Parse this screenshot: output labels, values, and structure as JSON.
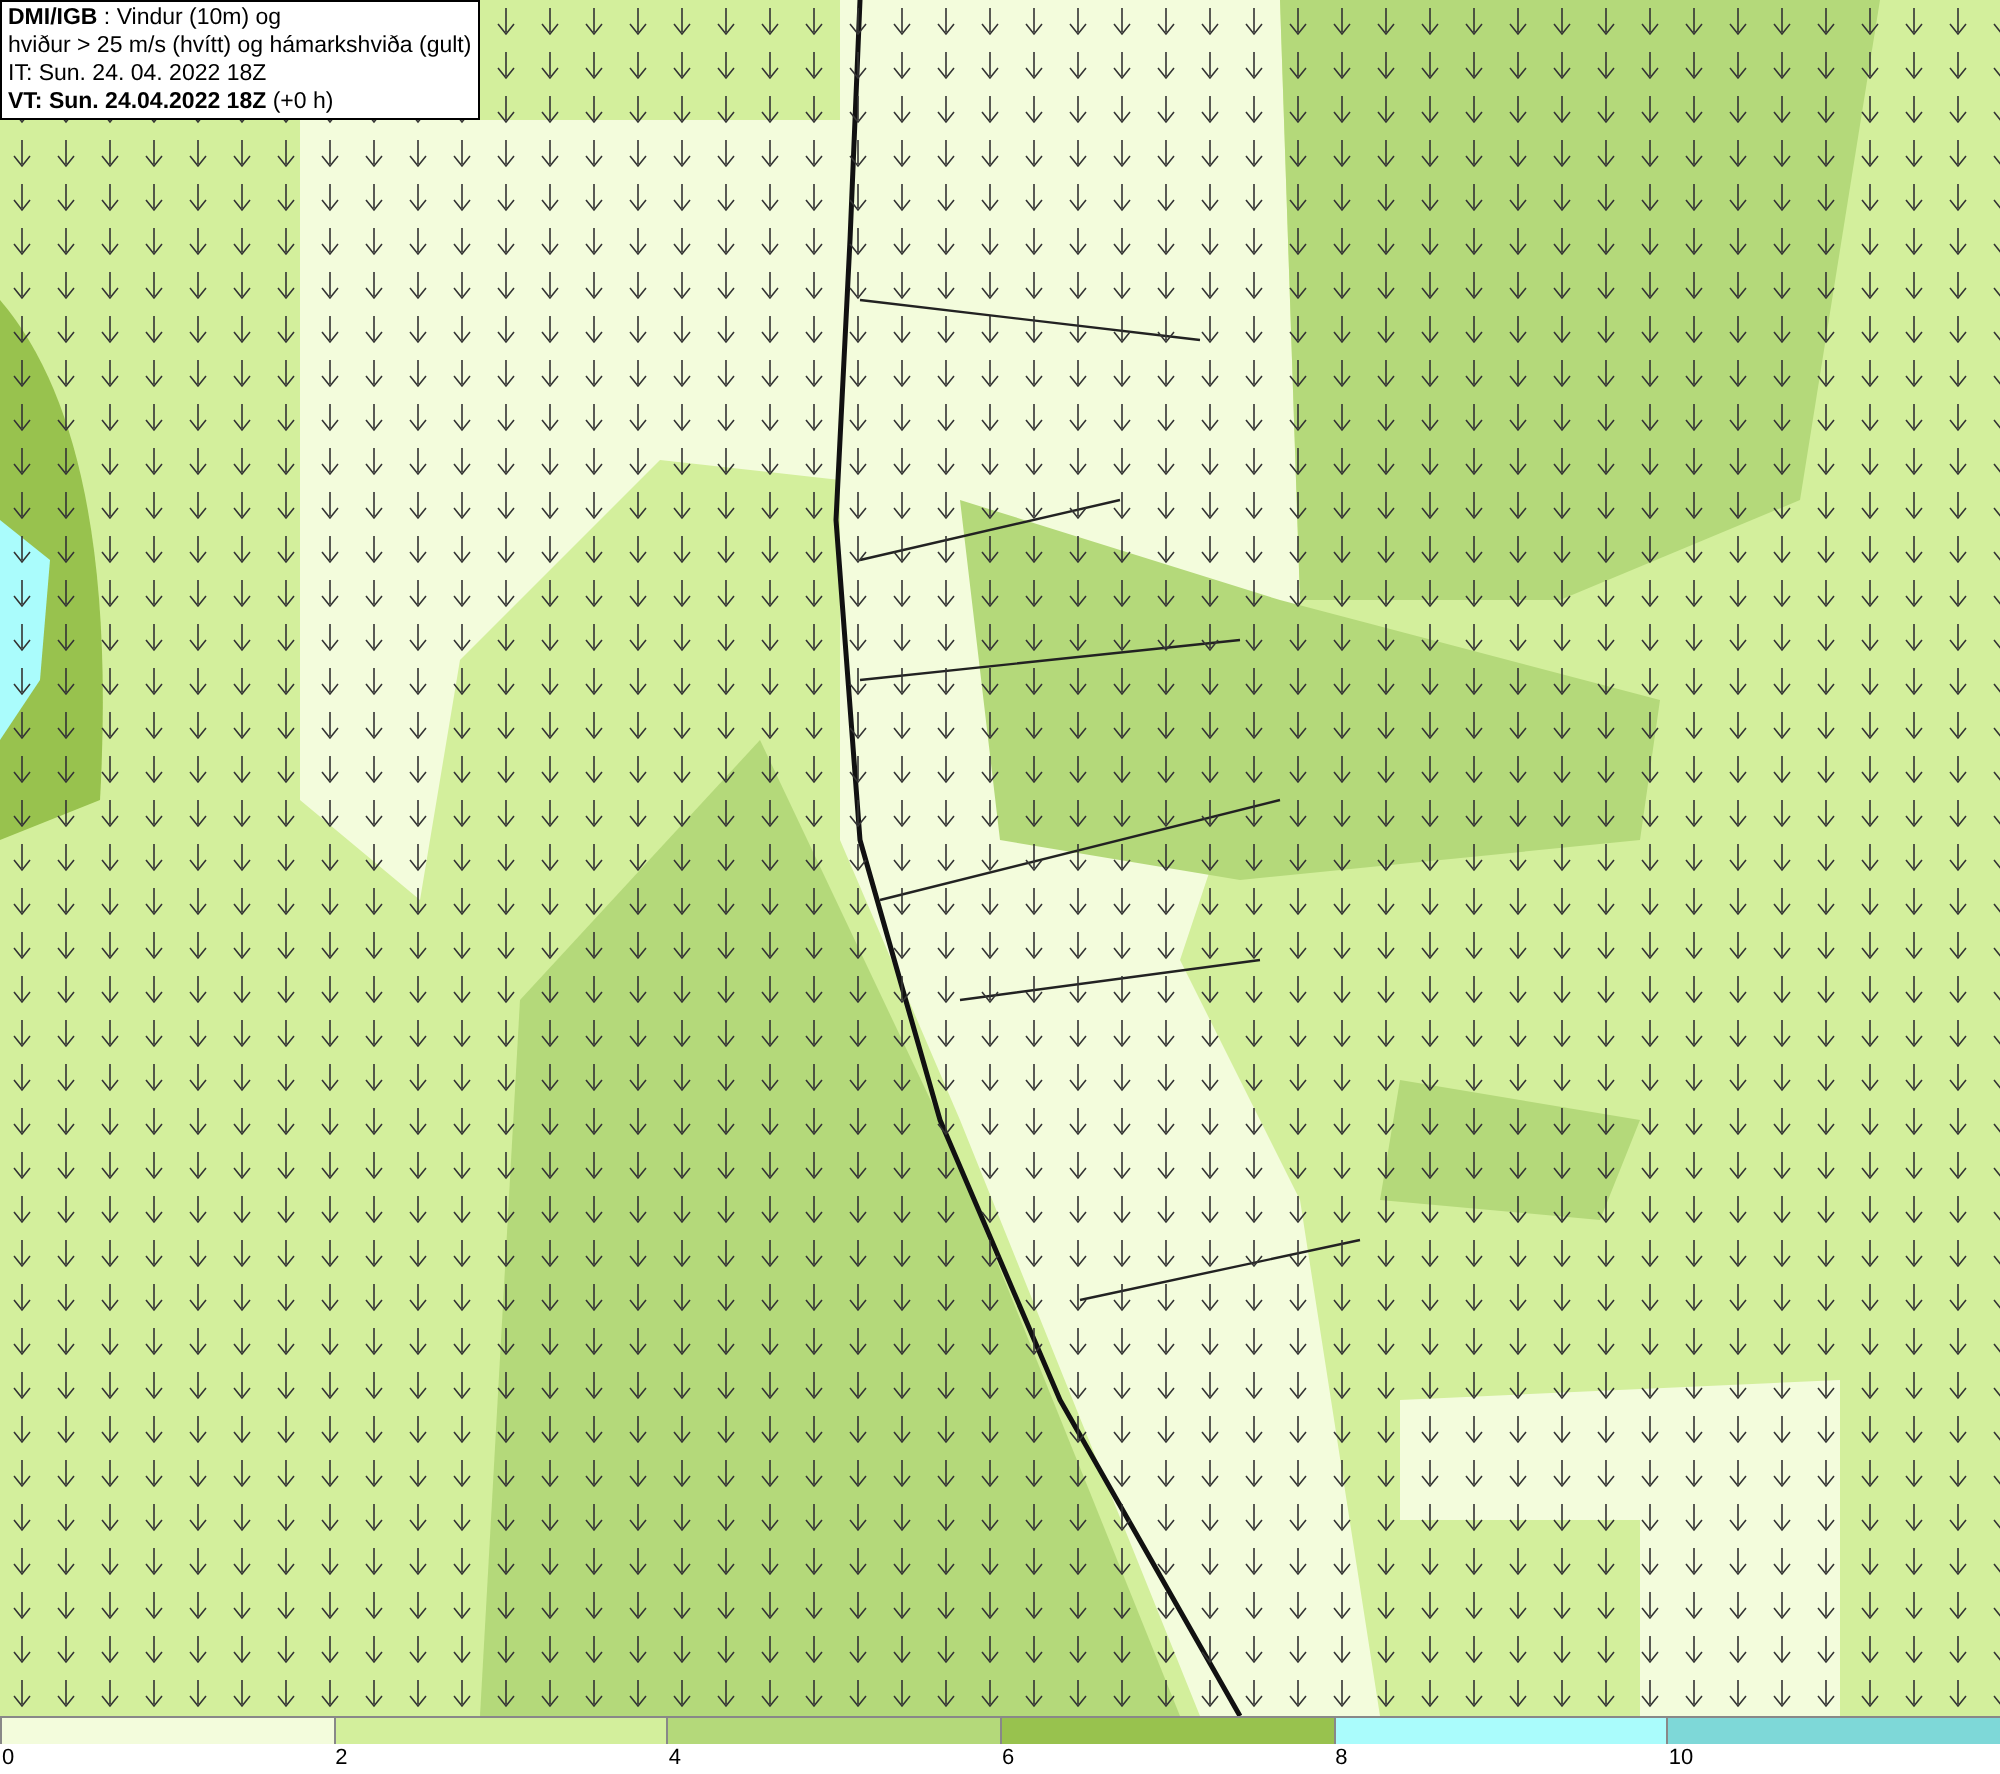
{
  "info_box": {
    "lines": [
      "**DMI/IGB** : Vindur (10m) og",
      "hviður > 25 m/s (hvítt) og hámarkshviða (gult)",
      "IT: Sun. 24. 04. 2022 18Z",
      "**VT: Sun. 24.04.2022 18Z** (+0 h)"
    ]
  },
  "legend": {
    "bins": [
      {
        "label": "0",
        "color": "#f3fcdc"
      },
      {
        "label": "2",
        "color": "#d3ef9c"
      },
      {
        "label": "4",
        "color": "#b4d97a"
      },
      {
        "label": "6",
        "color": "#98c24e"
      },
      {
        "label": "8",
        "color": "#aafcfc"
      },
      {
        "label": "10",
        "color": "#7ed8d8"
      }
    ]
  }
}
